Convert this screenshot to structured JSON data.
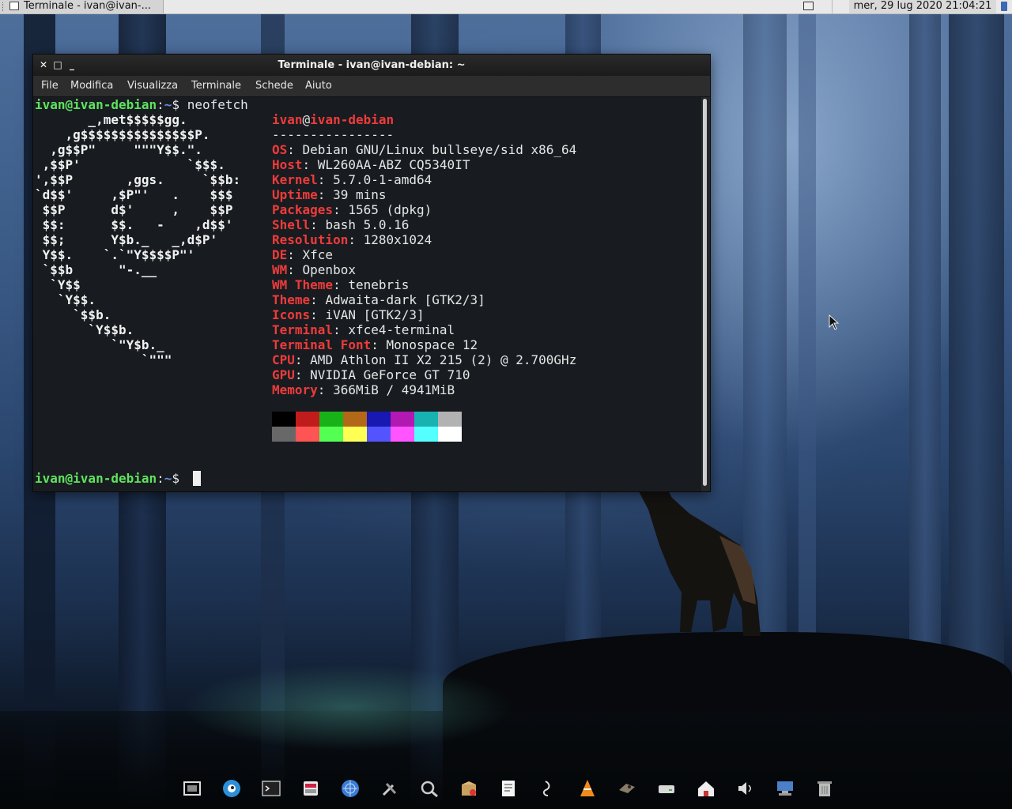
{
  "panel": {
    "task_label": "Terminale - ivan@ivan-...",
    "clock": "mer, 29 lug 2020  21:04:21"
  },
  "window": {
    "title": "Terminale - ivan@ivan-debian: ~",
    "controls": [
      "close",
      "maximize",
      "minimize"
    ]
  },
  "menubar": {
    "items": [
      "File",
      "Modifica",
      "Visualizza",
      "Terminale",
      "Schede",
      "Aiuto"
    ]
  },
  "terminal": {
    "prompt_user": "ivan@ivan-debian",
    "prompt_sep": ":",
    "prompt_path": "~",
    "prompt_symbol": "$",
    "command": "neofetch",
    "ascii_logo": [
      "       _,met$$$$$gg.",
      "    ,g$$$$$$$$$$$$$$$P.",
      "  ,g$$P\"     \"\"\"Y$$.\".",
      " ,$$P'              `$$$.",
      "',$$P       ,ggs.     `$$b:",
      "`d$$'     ,$P\"'   .    $$$",
      " $$P      d$'     ,    $$P",
      " $$:      $$.   -    ,d$$'",
      " $$;      Y$b._   _,d$P'",
      " Y$$.    `.`\"Y$$$$P\"'",
      " `$$b      \"-.__",
      "  `Y$$",
      "   `Y$$.",
      "     `$$b.",
      "       `Y$$b.",
      "          `\"Y$b._",
      "              `\"\"\""
    ],
    "info_user": "ivan",
    "info_at": "@",
    "info_host": "ivan-debian",
    "info_separator": "----------------",
    "info": [
      {
        "key": "OS",
        "value": "Debian GNU/Linux bullseye/sid x86_64"
      },
      {
        "key": "Host",
        "value": "WL260AA-ABZ CQ5340IT"
      },
      {
        "key": "Kernel",
        "value": "5.7.0-1-amd64"
      },
      {
        "key": "Uptime",
        "value": "39 mins"
      },
      {
        "key": "Packages",
        "value": "1565 (dpkg)"
      },
      {
        "key": "Shell",
        "value": "bash 5.0.16"
      },
      {
        "key": "Resolution",
        "value": "1280x1024"
      },
      {
        "key": "DE",
        "value": "Xfce"
      },
      {
        "key": "WM",
        "value": "Openbox"
      },
      {
        "key": "WM Theme",
        "value": "tenebris"
      },
      {
        "key": "Theme",
        "value": "Adwaita-dark [GTK2/3]"
      },
      {
        "key": "Icons",
        "value": "iVAN [GTK2/3]"
      },
      {
        "key": "Terminal",
        "value": "xfce4-terminal"
      },
      {
        "key": "Terminal Font",
        "value": "Monospace 12"
      },
      {
        "key": "CPU",
        "value": "AMD Athlon II X2 215 (2) @ 2.700GHz"
      },
      {
        "key": "GPU",
        "value": "NVIDIA GeForce GT 710"
      },
      {
        "key": "Memory",
        "value": "366MiB / 4941MiB"
      }
    ],
    "palette_row1": [
      "#000000",
      "#c01c1c",
      "#18b218",
      "#b26818",
      "#1818b2",
      "#b218b2",
      "#18b2b2",
      "#b2b2b2"
    ],
    "palette_row2": [
      "#686868",
      "#ff5454",
      "#54ff54",
      "#ffff54",
      "#5454ff",
      "#ff54ff",
      "#54ffff",
      "#ffffff"
    ]
  },
  "dock": {
    "icons": [
      "screenshot-icon",
      "finch-browser-icon",
      "terminal-icon",
      "file-manager-icon",
      "web-browser-icon",
      "settings-tools-icon",
      "search-icon",
      "package-manager-icon",
      "text-editor-icon",
      "audio-mixer-icon",
      "vlc-icon",
      "image-editor-icon",
      "drive-icon",
      "home-folder-icon",
      "volume-icon",
      "network-icon",
      "trash-icon"
    ]
  }
}
